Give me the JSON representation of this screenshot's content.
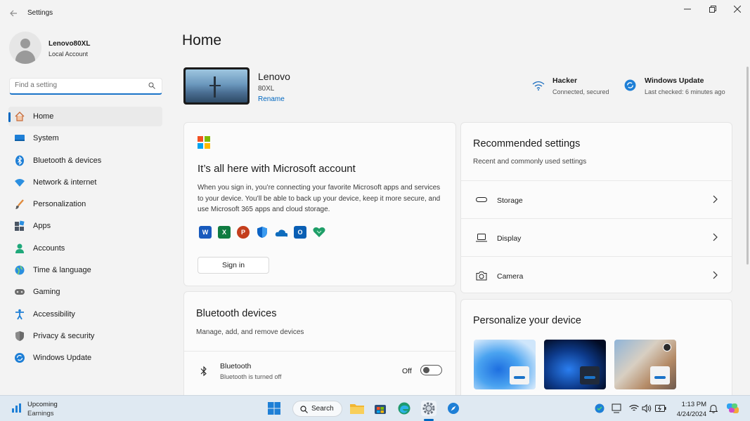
{
  "window": {
    "title": "Settings",
    "back_icon": "back-arrow-icon",
    "controls": [
      "minimize-icon",
      "restore-icon",
      "close-icon"
    ]
  },
  "user": {
    "name": "Lenovo80XL",
    "account_type": "Local Account"
  },
  "search": {
    "placeholder": "Find a setting",
    "icon": "search-icon"
  },
  "nav": {
    "items": [
      {
        "label": "Home",
        "icon": "home-icon",
        "active": true
      },
      {
        "label": "System",
        "icon": "system-icon"
      },
      {
        "label": "Bluetooth & devices",
        "icon": "bluetooth-icon"
      },
      {
        "label": "Network & internet",
        "icon": "network-icon"
      },
      {
        "label": "Personalization",
        "icon": "brush-icon"
      },
      {
        "label": "Apps",
        "icon": "apps-icon"
      },
      {
        "label": "Accounts",
        "icon": "accounts-icon"
      },
      {
        "label": "Time & language",
        "icon": "globe-icon"
      },
      {
        "label": "Gaming",
        "icon": "gamepad-icon"
      },
      {
        "label": "Accessibility",
        "icon": "accessibility-icon"
      },
      {
        "label": "Privacy & security",
        "icon": "shield-icon"
      },
      {
        "label": "Windows Update",
        "icon": "windows-update-icon"
      }
    ]
  },
  "main": {
    "title": "Home",
    "device": {
      "name": "Lenovo",
      "model": "80XL",
      "rename": "Rename"
    },
    "status": {
      "wifi": {
        "title": "Hacker",
        "sub": "Connected, secured",
        "icon": "wifi-icon"
      },
      "update": {
        "title": "Windows Update",
        "sub": "Last checked: 6 minutes ago",
        "icon": "windows-update-icon"
      }
    },
    "ms_card": {
      "title": "It’s all here with Microsoft account",
      "description": "When you sign in, you’re connecting your favorite Microsoft apps and services to your device. You’ll be able to back up your device, keep it more secure, and use Microsoft 365 apps and cloud storage.",
      "apps": [
        {
          "icon": "word-icon",
          "letter": "W",
          "color": "#185abd"
        },
        {
          "icon": "excel-icon",
          "letter": "X",
          "color": "#107c41"
        },
        {
          "icon": "powerpoint-icon",
          "letter": "P",
          "color": "#c43e1c"
        },
        {
          "icon": "defender-icon",
          "letter": "",
          "color": "#0b63c5"
        },
        {
          "icon": "onedrive-icon",
          "letter": "",
          "color": "#0f6cbd"
        },
        {
          "icon": "outlook-icon",
          "letter": "O",
          "color": "#0a5fb4"
        },
        {
          "icon": "family-icon",
          "letter": "",
          "color": "#1f9e68"
        }
      ],
      "button": "Sign in"
    },
    "recommended": {
      "title": "Recommended settings",
      "sub": "Recent and commonly used settings",
      "rows": [
        {
          "label": "Storage",
          "icon": "storage-icon"
        },
        {
          "label": "Display",
          "icon": "display-icon"
        },
        {
          "label": "Camera",
          "icon": "camera-icon"
        }
      ]
    },
    "bluetooth": {
      "title": "Bluetooth devices",
      "sub": "Manage, add, and remove devices",
      "row_title": "Bluetooth",
      "row_sub": "Bluetooth is turned off",
      "state": "Off",
      "enabled": false
    },
    "personalize": {
      "title": "Personalize your device",
      "themes": [
        "windows-light-theme",
        "windows-dark-theme",
        "glow-theme"
      ]
    }
  },
  "taskbar": {
    "widget_title": "Upcoming",
    "widget_sub": "Earnings",
    "search_label": "Search",
    "apps": [
      "start-icon",
      "search-icon",
      "file-explorer-icon",
      "store-icon",
      "edge-icon",
      "settings-icon",
      "safari-compass-icon"
    ],
    "tray": [
      "defender-tray-icon",
      "battery-saver-icon",
      "wifi-icon",
      "volume-icon",
      "battery-icon"
    ],
    "time": "1:13 PM",
    "date": "4/24/2024"
  },
  "colors": {
    "accent": "#0067c0",
    "background": "#f3f3f3",
    "card": "#fbfbfb",
    "taskbar": "#dfe9f2"
  }
}
